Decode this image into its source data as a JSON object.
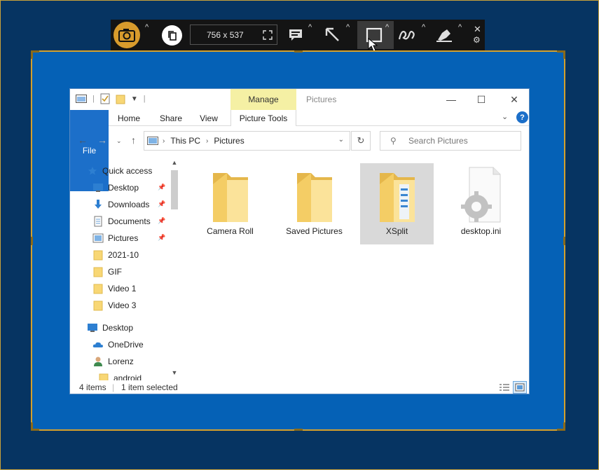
{
  "toolbar": {
    "size_label": "756 x 537"
  },
  "explorer": {
    "quick_access_toolbar": [
      "properties-icon",
      "folder-icon"
    ],
    "contextual_tab": "Manage",
    "window_title": "Pictures",
    "ribbon_tabs": {
      "file": "File",
      "home": "Home",
      "share": "Share",
      "view": "View",
      "picture_tools": "Picture Tools"
    },
    "address": {
      "crumbs": [
        "This PC",
        "Pictures"
      ]
    },
    "search": {
      "placeholder": "Search Pictures"
    },
    "nav_items": [
      {
        "label": "Quick access",
        "icon": "star-icon"
      },
      {
        "label": "Desktop",
        "icon": "desktop-icon",
        "pinned": true
      },
      {
        "label": "Downloads",
        "icon": "download-icon",
        "pinned": true
      },
      {
        "label": "Documents",
        "icon": "documents-icon",
        "pinned": true
      },
      {
        "label": "Pictures",
        "icon": "pictures-icon",
        "pinned": true
      },
      {
        "label": "2021-10",
        "icon": "folder-icon"
      },
      {
        "label": "GIF",
        "icon": "folder-icon"
      },
      {
        "label": "Video 1",
        "icon": "folder-icon"
      },
      {
        "label": "Video 3",
        "icon": "folder-icon"
      },
      {
        "label": "Desktop",
        "icon": "desktop-icon"
      },
      {
        "label": "OneDrive",
        "icon": "cloud-icon"
      },
      {
        "label": "Lorenz",
        "icon": "user-icon"
      },
      {
        "label": "android",
        "icon": "folder-icon"
      }
    ],
    "files": [
      {
        "name": "Camera Roll",
        "type": "folder"
      },
      {
        "name": "Saved Pictures",
        "type": "folder"
      },
      {
        "name": "XSplit",
        "type": "folder",
        "selected": true
      },
      {
        "name": "desktop.ini",
        "type": "settings-file"
      }
    ],
    "status": {
      "count": "4 items",
      "selection": "1 item selected"
    }
  },
  "colors": {
    "background": "#063462",
    "capture_fill": "#0561b6",
    "capture_border": "#d4a02c",
    "accent": "#1c6fc9",
    "camera_button": "#d89b2c",
    "manage_tab": "#f5f0a4"
  }
}
